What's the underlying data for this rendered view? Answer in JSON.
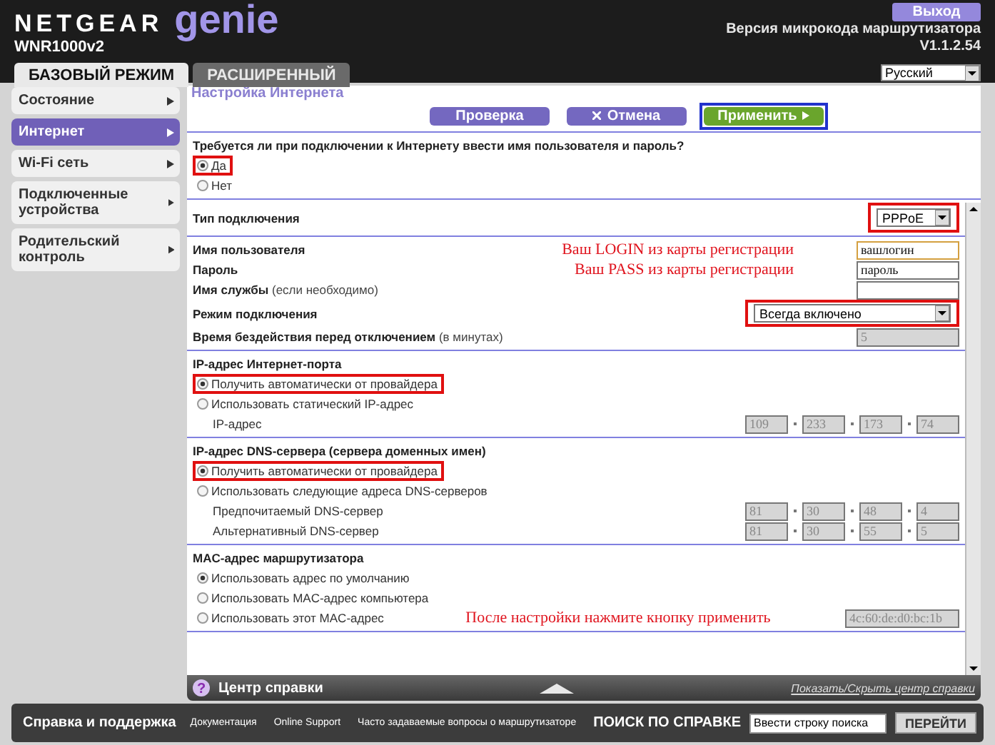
{
  "header": {
    "brand": "NETGEAR",
    "product": "genie",
    "model": "WNR1000v2",
    "logout": "Выход",
    "firmware_label": "Версия микрокода маршрутизатора",
    "firmware_version": "V1.1.2.54",
    "language": "Русский"
  },
  "tabs": [
    {
      "label": "БАЗОВЫЙ РЕЖИМ",
      "selected": true
    },
    {
      "label": "РАСШИРЕННЫЙ",
      "selected": false
    }
  ],
  "sidebar": {
    "items": [
      {
        "label": "Состояние",
        "selected": false
      },
      {
        "label": "Интернет",
        "selected": true
      },
      {
        "label": "Wi-Fi сеть",
        "selected": false
      },
      {
        "label": "Подключенные устройства",
        "selected": false
      },
      {
        "label": "Родительский контроль",
        "selected": false
      }
    ]
  },
  "page": {
    "title": "Настройка Интернета",
    "buttons": [
      {
        "label": "Проверка",
        "kind": "test",
        "callout": false
      },
      {
        "label": "Отмена",
        "kind": "cancel",
        "callout": false
      },
      {
        "label": "Применить",
        "kind": "apply",
        "callout": true
      }
    ],
    "login_section": [
      {
        "kind": "heading",
        "label": "Требуется ли при подключении к Интернету ввести имя пользователя и пароль?"
      },
      {
        "kind": "radio",
        "label": "Да",
        "selected": true,
        "callout": true
      },
      {
        "kind": "radio",
        "label": "Нет",
        "selected": false,
        "callout": false
      }
    ],
    "sections": [
      [
        {
          "kind": "select",
          "label": "Тип подключения",
          "value": "PPPoE",
          "callout": true
        }
      ],
      [
        {
          "kind": "input",
          "label": "Имя пользователя",
          "value": "вашлогин",
          "focused": true,
          "note": "Ваш LOGIN из карты регистрации"
        },
        {
          "kind": "input",
          "label": "Пароль",
          "value": "пароль",
          "focused": false,
          "note": "Ваш PASS из карты регистрации"
        },
        {
          "kind": "input",
          "label": "Имя службы",
          "hint": "(если необходимо)",
          "focused": false
        },
        {
          "kind": "wide_select",
          "label": "Режим подключения",
          "value": "Всегда включено",
          "callout": true
        },
        {
          "kind": "input",
          "label": "Время бездействия перед отключением",
          "hint": "(в минутах)",
          "value": "5",
          "disabled": true,
          "focused": false
        }
      ],
      [
        {
          "kind": "heading",
          "label": "IP-адрес Интернет-порта"
        },
        {
          "kind": "radio",
          "label": "Получить автоматически от провайдера",
          "selected": true,
          "callout": true
        },
        {
          "kind": "radio",
          "label": "Использовать статический IP-адрес",
          "selected": false,
          "callout": false
        },
        {
          "kind": "ip",
          "label": "IP-адрес",
          "octets": [
            "109",
            "233",
            "173",
            "74"
          ]
        }
      ],
      [
        {
          "kind": "heading",
          "label": "IP-адрес DNS-сервера (сервера доменных имен)"
        },
        {
          "kind": "radio",
          "label": "Получить автоматически от провайдера",
          "selected": true,
          "callout": true
        },
        {
          "kind": "radio",
          "label": "Использовать следующие адреса DNS-серверов",
          "selected": false,
          "callout": false
        },
        {
          "kind": "ip",
          "label": "Предпочитаемый DNS-сервер",
          "octets": [
            "81",
            "30",
            "48",
            "4"
          ]
        },
        {
          "kind": "ip",
          "label": "Альтернативный DNS-сервер",
          "octets": [
            "81",
            "30",
            "55",
            "5"
          ]
        }
      ],
      [
        {
          "kind": "heading",
          "label": "MAC-адрес маршрутизатора"
        },
        {
          "kind": "radio",
          "label": "Использовать адрес по умолчанию",
          "selected": true,
          "callout": false
        },
        {
          "kind": "radio",
          "label": "Использовать MAC-адрес компьютера",
          "selected": false,
          "callout": false
        },
        {
          "kind": "radio",
          "label": "Использовать этот MAC-адрес",
          "selected": false,
          "callout": false,
          "note": "После настройки нажмите кнопку применить",
          "mac": "4c:60:de:d0:bc:1b"
        }
      ]
    ]
  },
  "help_bar": {
    "icon": "?",
    "title": "Центр справки",
    "toggle": "Показать/Скрыть центр справки"
  },
  "footer": {
    "title": "Справка и поддержка",
    "links": [
      "Документация",
      "Online Support",
      "Часто задаваемые вопросы о маршрутизаторе"
    ],
    "search_label": "ПОИСК ПО СПРАВКЕ",
    "search_value": "Ввести строку поиска",
    "go": "ПЕРЕЙТИ"
  }
}
